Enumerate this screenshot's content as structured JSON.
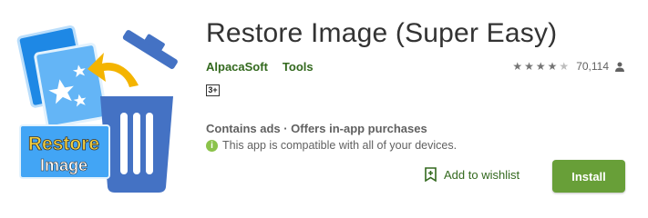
{
  "app": {
    "title": "Restore Image (Super Easy)",
    "developer": "AlpacaSoft",
    "category": "Tools",
    "content_rating": "3+",
    "rating_stars": 4,
    "rating_count": "70,114",
    "ads_info": "Contains ads · Offers in-app purchases",
    "compatibility": "This app is compatible with all of your devices.",
    "icon_text_line1": "Restore",
    "icon_text_line2": "Image"
  },
  "actions": {
    "wishlist_label": "Add to wishlist",
    "install_label": "Install"
  },
  "icons": {
    "app_icon": "restore-image-app-icon",
    "compat_icon": "info-icon",
    "wishlist_icon": "bookmark-plus-icon",
    "person_icon": "person-icon"
  },
  "colors": {
    "brand_green": "#689f38",
    "link_green": "#33691e"
  }
}
